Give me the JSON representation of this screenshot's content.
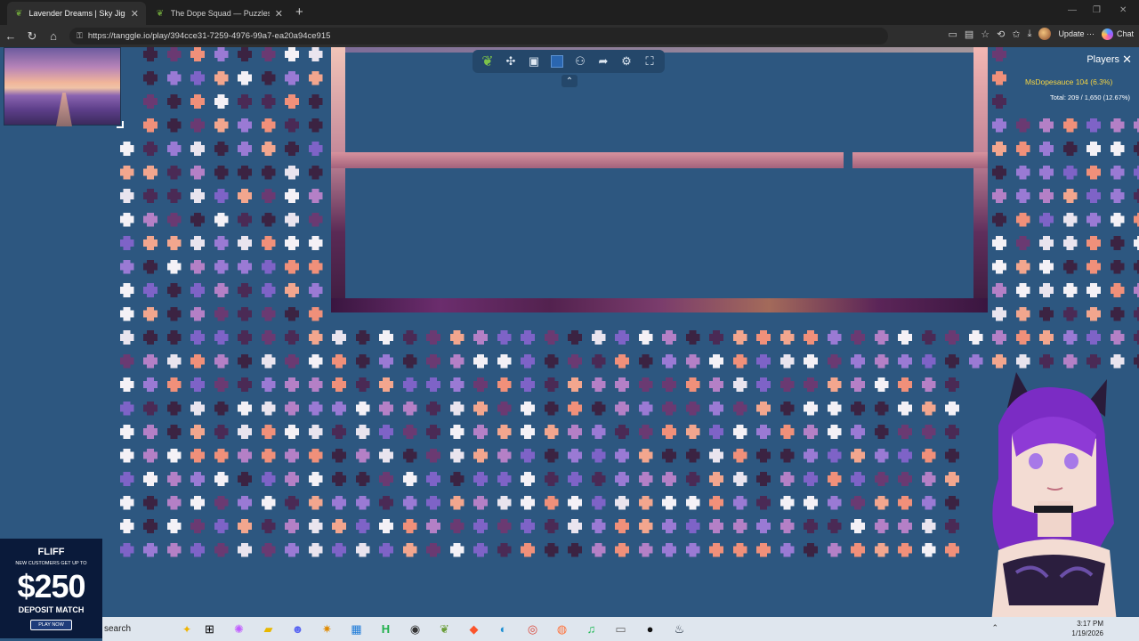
{
  "browser": {
    "tabs": [
      {
        "title": "Lavender Dreams | Sky Jigsaw",
        "active": true
      },
      {
        "title": "The Dope Squad — Puzzles",
        "active": false
      }
    ],
    "url": "https://tanggle.io/play/394cce31-7259-4976-99a7-ea20a94ce915",
    "update_label": "Update",
    "update_more": "···",
    "chat_label": "Chat"
  },
  "puzzle": {
    "toolbar_icons": [
      "leaf-icon",
      "puzzle-piece-icon",
      "image-icon",
      "square-icon",
      "users-icon",
      "share-icon",
      "settings-icon",
      "fullscreen-icon"
    ],
    "players_title": "Players",
    "player_row": "MsDopesauce  104 (6.3%)",
    "total_row": "Total: 209 / 1,650 (12.67%)"
  },
  "ad": {
    "brand": "FLIFF",
    "promo": "NEW CUSTOMERS GET UP TO",
    "amount": "$250",
    "deposit": "DEPOSIT MATCH",
    "cta": "PLAY NOW"
  },
  "taskbar": {
    "search_label": "search",
    "time": "3:17 PM",
    "date": "1/19/2026"
  }
}
